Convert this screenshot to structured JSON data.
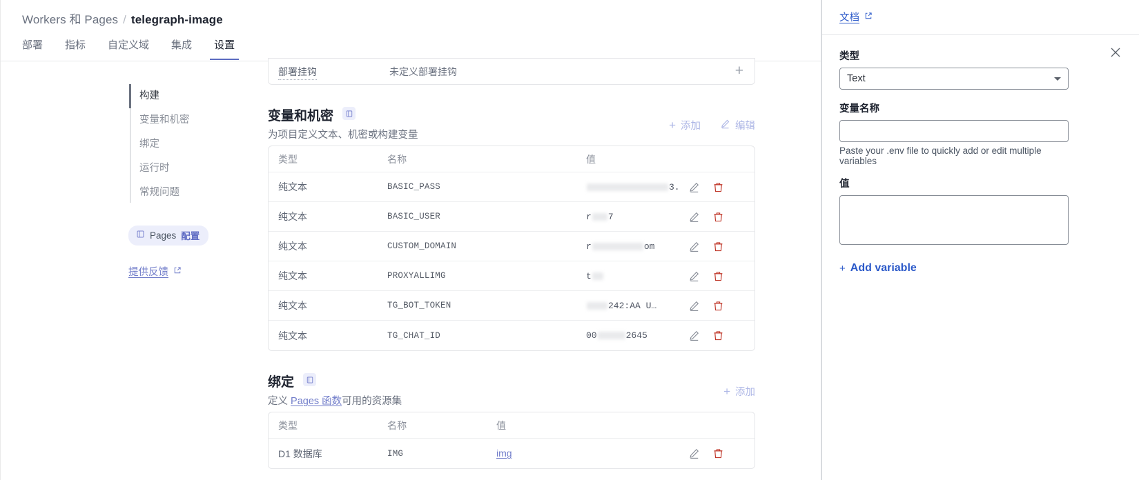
{
  "breadcrumb": {
    "root": "Workers 和 Pages",
    "separator": "/",
    "current": "telegraph-image"
  },
  "tabs": [
    {
      "label": "部署",
      "active": false
    },
    {
      "label": "指标",
      "active": false
    },
    {
      "label": "自定义域",
      "active": false
    },
    {
      "label": "集成",
      "active": false
    },
    {
      "label": "设置",
      "active": true
    }
  ],
  "subnav": {
    "items": [
      {
        "label": "构建",
        "active": true
      },
      {
        "label": "变量和机密",
        "active": false
      },
      {
        "label": "绑定",
        "active": false
      },
      {
        "label": "运行时",
        "active": false
      },
      {
        "label": "常规问题",
        "active": false
      }
    ],
    "pages_config_badge": "Pages 配置",
    "feedback_link": "提供反馈"
  },
  "deploy_hook_row": {
    "label": "部署挂钩",
    "value": "未定义部署挂钩",
    "add_glyph": "+"
  },
  "variables_section": {
    "title": "变量和机密",
    "subtitle": "为项目定义文本、机密或构建变量",
    "add_label": "添加",
    "add_glyph": "+",
    "edit_label": "编辑",
    "columns": [
      "类型",
      "名称",
      "值"
    ],
    "rows": [
      {
        "type": "纯文本",
        "name": "BASIC_PASS",
        "value_prefix": "",
        "value_suffix": "3.",
        "redacted": true
      },
      {
        "type": "纯文本",
        "name": "BASIC_USER",
        "value_prefix": "r",
        "value_suffix": "7",
        "redacted": true
      },
      {
        "type": "纯文本",
        "name": "CUSTOM_DOMAIN",
        "value_prefix": "r",
        "value_suffix": "om",
        "redacted": true
      },
      {
        "type": "纯文本",
        "name": "PROXYALLIMG",
        "value_prefix": "t",
        "value_suffix": "",
        "redacted": true
      },
      {
        "type": "纯文本",
        "name": "TG_BOT_TOKEN",
        "value_prefix": "",
        "value_suffix": "242:AA    U…",
        "redacted": true
      },
      {
        "type": "纯文本",
        "name": "TG_CHAT_ID",
        "value_prefix": "00",
        "value_suffix": "2645",
        "redacted": true
      }
    ]
  },
  "bindings_section": {
    "title": "绑定",
    "subtitle_pre": "定义 ",
    "subtitle_link": "Pages 函数",
    "subtitle_post": "可用的资源集",
    "add_label": "添加",
    "add_glyph": "+",
    "columns": [
      "类型",
      "名称",
      "值"
    ],
    "rows": [
      {
        "type": "D1 数据库",
        "name": "IMG",
        "value": "img"
      }
    ]
  },
  "right_panel": {
    "doc_link": "文档",
    "type_label": "类型",
    "type_value": "Text",
    "name_label": "变量名称",
    "name_value": "",
    "name_placeholder": "",
    "helper_text": "Paste your .env file to quickly add or edit multiple variables",
    "value_label": "值",
    "value_value": "",
    "value_placeholder": "",
    "add_variable_label": "Add variable",
    "add_variable_glyph": "+"
  },
  "colors": {
    "accent_blue": "#2b59c9",
    "link_purple": "#6f7bc9",
    "tab_underline": "#5b6bc0",
    "text_primary": "#1f2430",
    "text_muted": "#6b7280",
    "border": "#e5e6e9"
  }
}
